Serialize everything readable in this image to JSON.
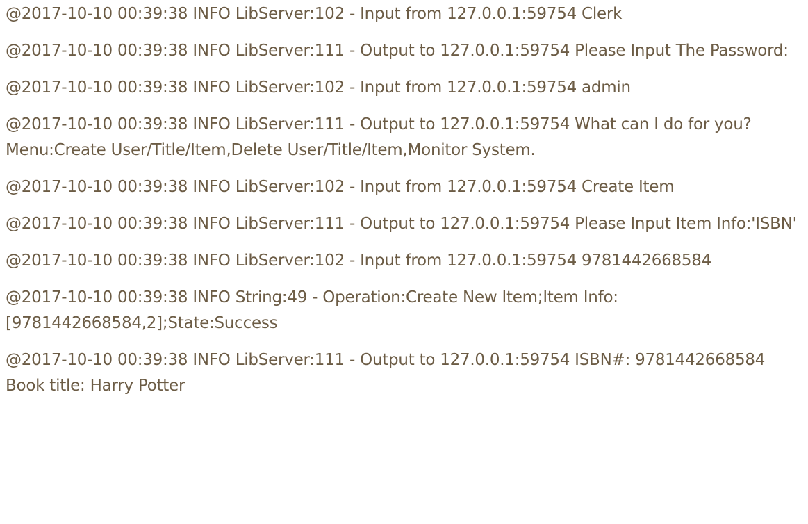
{
  "log": {
    "lines": [
      "@2017-10-10 00:39:38 INFO  LibServer:102 - Input from 127.0.0.1:59754 Clerk",
      "@2017-10-10 00:39:38 INFO  LibServer:111 - Output to 127.0.0.1:59754 Please Input The Password:",
      "@2017-10-10 00:39:38 INFO  LibServer:102 - Input from 127.0.0.1:59754 admin",
      "@2017-10-10 00:39:38 INFO  LibServer:111 - Output to 127.0.0.1:59754 What can I do for you?Menu:Create User/Title/Item,Delete User/Title/Item,Monitor System.",
      "@2017-10-10 00:39:38 INFO  LibServer:102 - Input from 127.0.0.1:59754 Create Item",
      "@2017-10-10 00:39:38 INFO  LibServer:111 - Output to 127.0.0.1:59754 Please Input Item Info:'ISBN'",
      "@2017-10-10 00:39:38 INFO  LibServer:102 - Input from 127.0.0.1:59754 9781442668584",
      "@2017-10-10 00:39:38 INFO  String:49 - Operation:Create New Item;Item Info:[9781442668584,2];State:Success",
      "@2017-10-10 00:39:38 INFO  LibServer:111 - Output to 127.0.0.1:59754 ISBN#: 9781442668584 Book title: Harry Potter"
    ]
  }
}
